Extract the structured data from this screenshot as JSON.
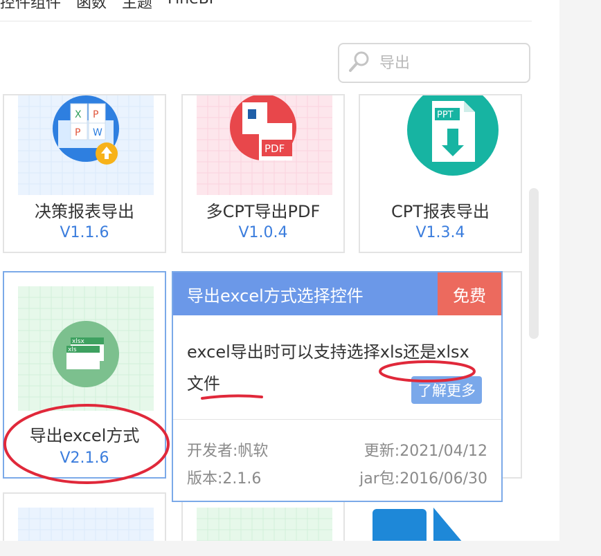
{
  "top_tabs": [
    "控件组件",
    "函数",
    "主题",
    "FineBI"
  ],
  "search": {
    "placeholder": "导出",
    "icon": "search-icon"
  },
  "cards": [
    {
      "name": "决策报表导出",
      "version": "V1.1.6"
    },
    {
      "name": "多CPT导出PDF",
      "version": "V1.0.4"
    },
    {
      "name": "CPT报表导出",
      "version": "V1.3.4"
    },
    {
      "name": "导出excel方式",
      "version": "V2.1.6"
    }
  ],
  "popup": {
    "title": "导出excel方式选择控件",
    "badge": "免费",
    "description": "excel导出时可以支持选择xls还是xlsx文件",
    "learn_more": "了解更多",
    "developer": "开发者:帆软",
    "updated": "更新:2021/04/12",
    "version": "版本:2.1.6",
    "jar": "jar包:2016/06/30"
  },
  "icon_labels": {
    "ppt": "PPT",
    "pdf": "PDF",
    "xlsx": "xlsx",
    "xls": "xls",
    "x": "X",
    "p": "P",
    "w": "W"
  },
  "colors": {
    "accent_blue": "#6b98e8",
    "version_blue": "#3b7ddd",
    "free_red": "#ec6a5e",
    "annotation_red": "#e0283a"
  }
}
